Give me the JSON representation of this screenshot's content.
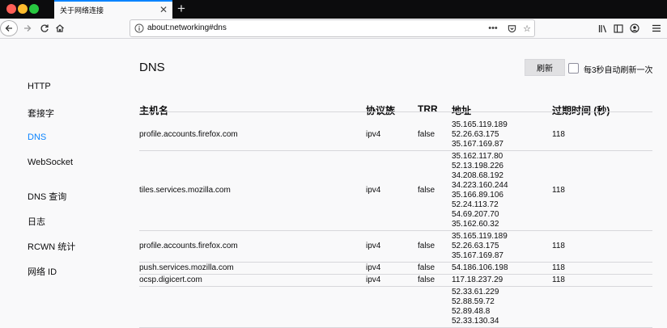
{
  "tab": {
    "title": "关于网络连接",
    "close_icon": "close-icon"
  },
  "urlbar": {
    "url": "about:networking#dns"
  },
  "sidebar": {
    "items": [
      {
        "label": "HTTP",
        "active": false
      },
      {
        "label": "套接字",
        "active": false
      },
      {
        "label": "DNS",
        "active": true
      },
      {
        "label": "WebSocket",
        "active": false
      },
      {
        "label": "DNS 查询",
        "active": false
      },
      {
        "label": "日志",
        "active": false
      },
      {
        "label": "RCWN 统计",
        "active": false
      },
      {
        "label": "网络 ID",
        "active": false
      }
    ]
  },
  "main": {
    "title": "DNS",
    "refresh_label": "刷新",
    "auto_refresh_label": "每3秒自动刷新一次",
    "auto_refresh_checked": false,
    "columns": [
      "主机名",
      "协议族",
      "TRR",
      "地址",
      "过期时间 (秒)"
    ],
    "rows": [
      {
        "hostname": "profile.accounts.firefox.com",
        "family": "ipv4",
        "trr": "false",
        "addresses": [
          "35.165.119.189",
          "52.26.63.175",
          "35.167.169.87"
        ],
        "expires": "118"
      },
      {
        "hostname": "tiles.services.mozilla.com",
        "family": "ipv4",
        "trr": "false",
        "addresses": [
          "35.162.117.80",
          "52.13.198.226",
          "34.208.68.192",
          "34.223.160.244",
          "35.166.89.106",
          "52.24.113.72",
          "54.69.207.70",
          "35.162.60.32"
        ],
        "expires": "118"
      },
      {
        "hostname": "profile.accounts.firefox.com",
        "family": "ipv4",
        "trr": "false",
        "addresses": [
          "35.165.119.189",
          "52.26.63.175",
          "35.167.169.87"
        ],
        "expires": "118"
      },
      {
        "hostname": "push.services.mozilla.com",
        "family": "ipv4",
        "trr": "false",
        "addresses": [
          "54.186.106.198"
        ],
        "expires": "118"
      },
      {
        "hostname": "ocsp.digicert.com",
        "family": "ipv4",
        "trr": "false",
        "addresses": [
          "117.18.237.29"
        ],
        "expires": "118"
      },
      {
        "hostname": "",
        "family": "",
        "trr": "",
        "addresses": [
          "52.33.61.229",
          "52.88.59.72",
          "52.89.48.8",
          "52.33.130.34"
        ],
        "expires": ""
      }
    ]
  }
}
